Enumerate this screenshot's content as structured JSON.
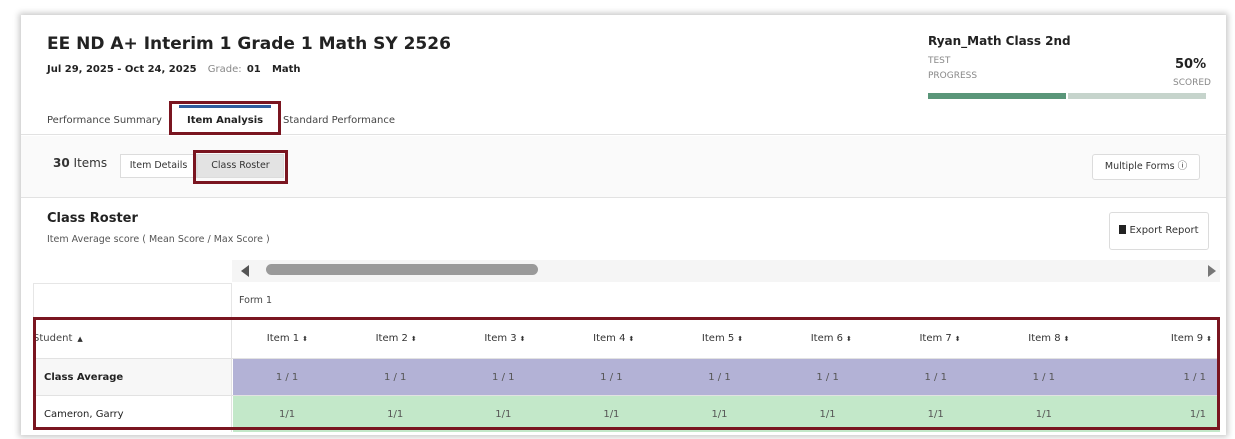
{
  "header": {
    "title": "EE ND A+ Interim 1 Grade 1 Math SY 2526",
    "dates": "Jul 29, 2025 - Oct 24, 2025",
    "grade_label": "Grade:",
    "grade_value": "01",
    "subject": "Math"
  },
  "class_info": {
    "name": "Ryan_Math Class 2nd",
    "progress_label_1": "TEST",
    "progress_label_2": "PROGRESS",
    "percent": "50%",
    "scored_label": "SCORED",
    "progress_fraction": 0.5
  },
  "tabs": [
    {
      "label": "Performance Summary"
    },
    {
      "label": "Item Analysis"
    },
    {
      "label": "Standard Performance"
    }
  ],
  "toolbar": {
    "count": "30",
    "count_label": "Items",
    "item_details_label": "Item Details",
    "class_roster_label": "Class Roster",
    "multiple_forms_label": "Multiple Forms ⓘ"
  },
  "roster": {
    "title": "Class Roster",
    "subtitle": "Item Average score ( Mean Score / Max Score )",
    "export_label": "Export Report"
  },
  "table": {
    "form_label": "Form 1",
    "student_header": "Student",
    "items": [
      "Item 1",
      "Item 2",
      "Item 3",
      "Item 4",
      "Item 5",
      "Item 6",
      "Item 7",
      "Item 8",
      "Item 9"
    ],
    "class_average": {
      "label": "Class Average",
      "values": [
        "1 / 1",
        "1 / 1",
        "1 / 1",
        "1 / 1",
        "1 / 1",
        "1 / 1",
        "1 / 1",
        "1 / 1",
        "1 / 1"
      ]
    },
    "students": [
      {
        "name": "Cameron, Garry",
        "values": [
          "1/1",
          "1/1",
          "1/1",
          "1/1",
          "1/1",
          "1/1",
          "1/1",
          "1/1",
          "1/1"
        ]
      }
    ]
  },
  "colors": {
    "highlight": "#7a1520",
    "average_row": "#b3b2d6",
    "student_row": "#c3e8c9",
    "progress_fill": "#5a9679",
    "tab_accent": "#2f5d9e"
  }
}
